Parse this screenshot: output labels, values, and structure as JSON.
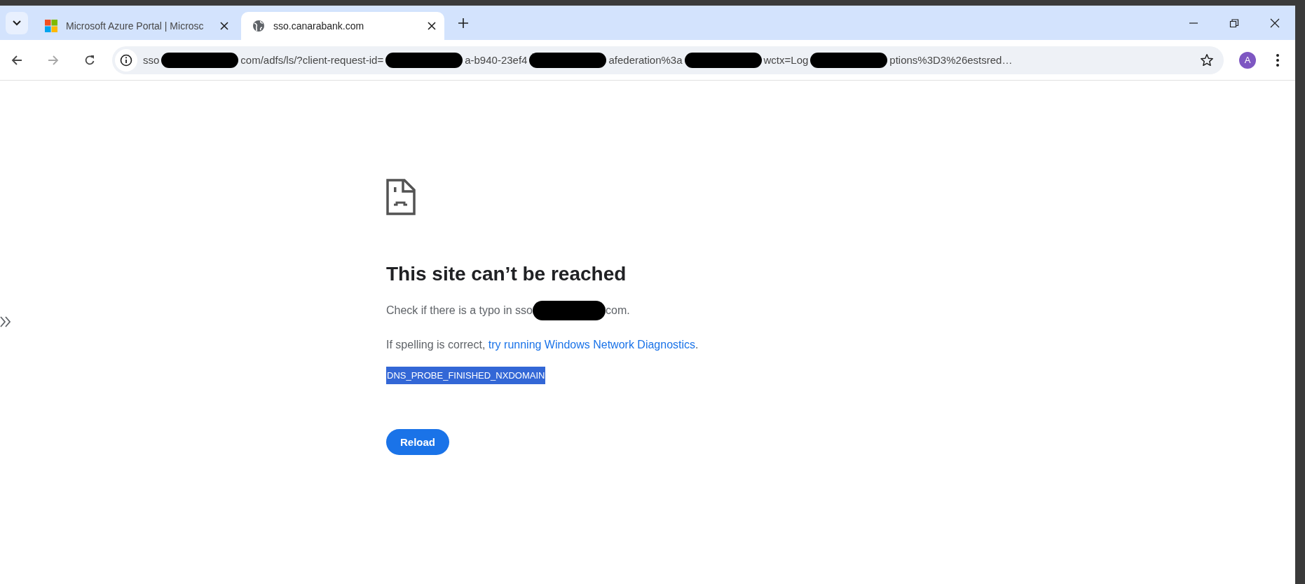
{
  "tabs": [
    {
      "title": "Microsoft Azure Portal | Microsc",
      "kind": "windows",
      "selected": false
    },
    {
      "title": "sso.canarabank.com",
      "kind": "globe",
      "selected": true
    }
  ],
  "address_bar": {
    "segments": [
      {
        "kind": "text",
        "text": "sso"
      },
      {
        "kind": "redaction"
      },
      {
        "kind": "text",
        "text": "com/adfs/ls/?client-request-id="
      },
      {
        "kind": "redaction"
      },
      {
        "kind": "text",
        "text": "a-b940-23ef4"
      },
      {
        "kind": "redaction"
      },
      {
        "kind": "text",
        "text": "afederation%3a"
      },
      {
        "kind": "redaction"
      },
      {
        "kind": "text",
        "text": "wctx=Log"
      },
      {
        "kind": "redaction"
      },
      {
        "kind": "text",
        "text": "ptions%3D3%26estsred…"
      }
    ]
  },
  "profile": {
    "initial": "A"
  },
  "error": {
    "title": "This site can’t be reached",
    "typo_before": "Check if there is a typo in sso",
    "typo_after": "com.",
    "spelling_text": "If spelling is correct, ",
    "spelling_link": "try running Windows Network Diagnostics",
    "spelling_end": ".",
    "code": "DNS_PROBE_FINISHED_NXDOMAIN",
    "code_selected": true,
    "reload": "Reload"
  }
}
